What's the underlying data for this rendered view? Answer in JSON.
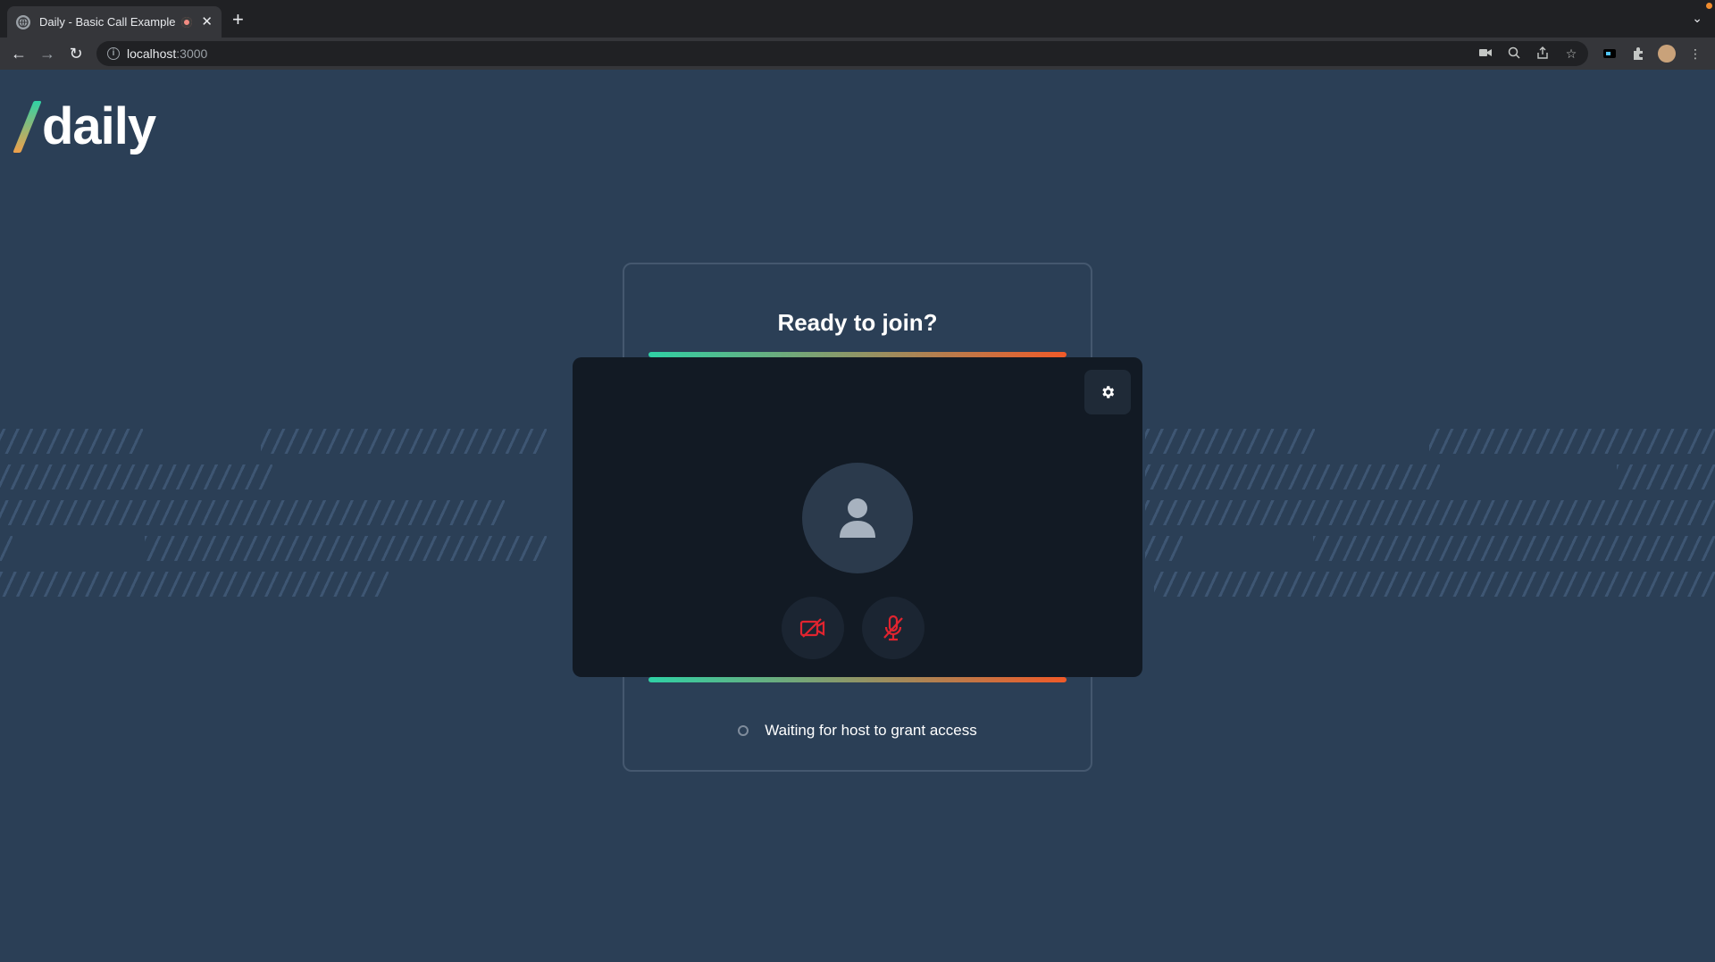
{
  "browser": {
    "tab_title": "Daily - Basic Call Example",
    "url_host": "localhost",
    "url_port": ":3000"
  },
  "app": {
    "logo_text": "daily",
    "card_title": "Ready to join?",
    "status_text": "Waiting for host to grant access",
    "accent_start": "#2fd1a5",
    "accent_end": "#f05a28",
    "muted_color": "#e0242f"
  }
}
